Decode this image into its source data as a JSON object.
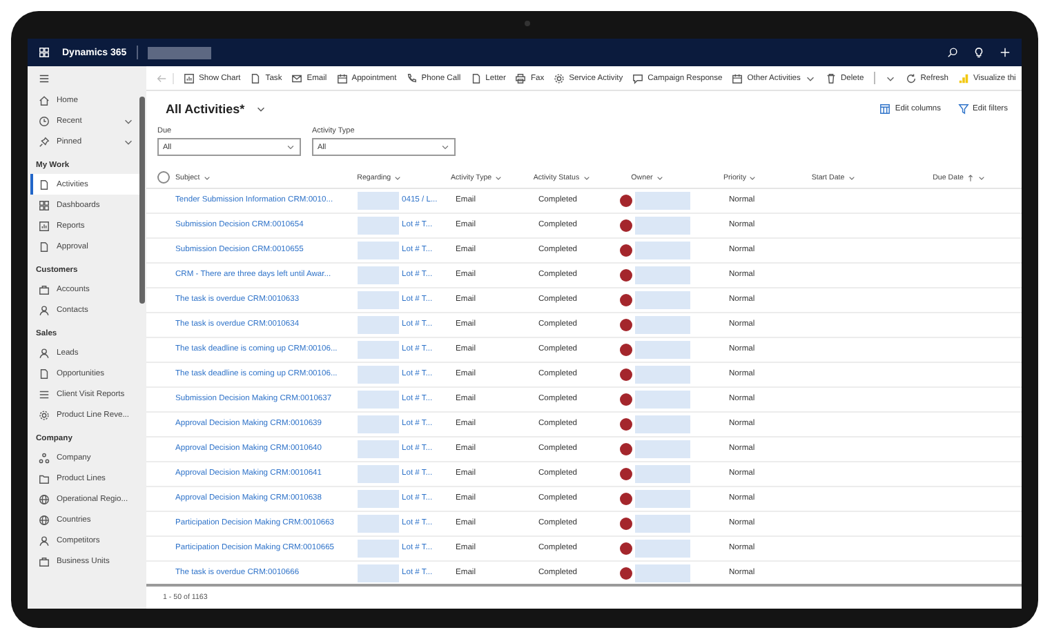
{
  "header": {
    "app_name": "Dynamics 365"
  },
  "sidebar": {
    "sections": [
      {
        "items": [
          {
            "label": "Home",
            "selected": false
          },
          {
            "label": "Recent",
            "selected": false,
            "expanded": false
          },
          {
            "label": "Pinned",
            "selected": false,
            "expanded": false
          }
        ]
      },
      {
        "title": "My Work",
        "items": [
          {
            "label": "Activities",
            "selected": true
          },
          {
            "label": "Dashboards",
            "selected": false
          },
          {
            "label": "Reports",
            "selected": false
          },
          {
            "label": "Approval",
            "selected": false
          }
        ]
      },
      {
        "title": "Customers",
        "items": [
          {
            "label": "Accounts",
            "selected": false
          },
          {
            "label": "Contacts",
            "selected": false
          }
        ]
      },
      {
        "title": "Sales",
        "items": [
          {
            "label": "Leads",
            "selected": false
          },
          {
            "label": "Opportunities",
            "selected": false
          },
          {
            "label": "Client Visit Reports",
            "selected": false
          },
          {
            "label": "Product Line Reve...",
            "selected": false
          }
        ]
      },
      {
        "title": "Company",
        "items": [
          {
            "label": "Company",
            "selected": false
          },
          {
            "label": "Product Lines",
            "selected": false
          },
          {
            "label": "Operational Regio...",
            "selected": false
          },
          {
            "label": "Countries",
            "selected": false
          },
          {
            "label": "Competitors",
            "selected": false
          },
          {
            "label": "Business Units",
            "selected": false
          }
        ]
      }
    ]
  },
  "commands": [
    {
      "label": "Show Chart",
      "kind": "button"
    },
    {
      "label": "Task",
      "kind": "button"
    },
    {
      "label": "Email",
      "kind": "button"
    },
    {
      "label": "Appointment",
      "kind": "button"
    },
    {
      "label": "Phone Call",
      "kind": "button"
    },
    {
      "label": "Letter",
      "kind": "button"
    },
    {
      "label": "Fax",
      "kind": "button"
    },
    {
      "label": "Service Activity",
      "kind": "button"
    },
    {
      "label": "Campaign Response",
      "kind": "button"
    },
    {
      "label": "Other Activities",
      "kind": "menu"
    },
    {
      "label": "Delete",
      "kind": "split"
    },
    {
      "label": "Refresh",
      "kind": "button"
    },
    {
      "label": "Visualize thi",
      "kind": "button"
    }
  ],
  "view": {
    "title": "All Activities*",
    "actions": [
      {
        "label": "Edit columns"
      },
      {
        "label": "Edit filters"
      }
    ]
  },
  "filters": [
    {
      "label": "Due",
      "value": "All"
    },
    {
      "label": "Activity Type",
      "value": "All"
    }
  ],
  "table": {
    "select_all_checked": false,
    "columns": [
      {
        "label": "Subject",
        "sorted": false
      },
      {
        "label": "Regarding",
        "sorted": false
      },
      {
        "label": "Activity Type",
        "sorted": false
      },
      {
        "label": "Activity Status",
        "sorted": false
      },
      {
        "label": "Owner",
        "sorted": false
      },
      {
        "label": "Priority",
        "sorted": false
      },
      {
        "label": "Start Date",
        "sorted": false
      },
      {
        "label": "Due Date",
        "sorted": true
      }
    ],
    "rows": [
      {
        "subject": "Tender Submission Information CRM:0010...",
        "regarding": "0415 / L...",
        "activity_type": "Email",
        "status": "Completed",
        "priority": "Normal"
      },
      {
        "subject": "Submission Decision CRM:0010654",
        "regarding": "Lot # T...",
        "activity_type": "Email",
        "status": "Completed",
        "priority": "Normal"
      },
      {
        "subject": "Submission Decision CRM:0010655",
        "regarding": "Lot # T...",
        "activity_type": "Email",
        "status": "Completed",
        "priority": "Normal"
      },
      {
        "subject": "CRM - There are three days left until Awar...",
        "regarding": "Lot # T...",
        "activity_type": "Email",
        "status": "Completed",
        "priority": "Normal"
      },
      {
        "subject": "The task is overdue CRM:0010633",
        "regarding": "Lot # T...",
        "activity_type": "Email",
        "status": "Completed",
        "priority": "Normal"
      },
      {
        "subject": "The task is overdue CRM:0010634",
        "regarding": "Lot # T...",
        "activity_type": "Email",
        "status": "Completed",
        "priority": "Normal"
      },
      {
        "subject": "The task deadline is coming up CRM:00106...",
        "regarding": "Lot # T...",
        "activity_type": "Email",
        "status": "Completed",
        "priority": "Normal"
      },
      {
        "subject": "The task deadline is coming up CRM:00106...",
        "regarding": "Lot # T...",
        "activity_type": "Email",
        "status": "Completed",
        "priority": "Normal"
      },
      {
        "subject": "Submission Decision Making CRM:0010637",
        "regarding": "Lot # T...",
        "activity_type": "Email",
        "status": "Completed",
        "priority": "Normal"
      },
      {
        "subject": "Approval Decision Making CRM:0010639",
        "regarding": "Lot # T...",
        "activity_type": "Email",
        "status": "Completed",
        "priority": "Normal"
      },
      {
        "subject": "Approval Decision Making CRM:0010640",
        "regarding": "Lot # T...",
        "activity_type": "Email",
        "status": "Completed",
        "priority": "Normal"
      },
      {
        "subject": "Approval Decision Making CRM:0010641",
        "regarding": "Lot # T...",
        "activity_type": "Email",
        "status": "Completed",
        "priority": "Normal"
      },
      {
        "subject": "Approval Decision Making CRM:0010638",
        "regarding": "Lot # T...",
        "activity_type": "Email",
        "status": "Completed",
        "priority": "Normal"
      },
      {
        "subject": "Participation Decision Making CRM:0010663",
        "regarding": "Lot # T...",
        "activity_type": "Email",
        "status": "Completed",
        "priority": "Normal"
      },
      {
        "subject": "Participation Decision Making CRM:0010665",
        "regarding": "Lot # T...",
        "activity_type": "Email",
        "status": "Completed",
        "priority": "Normal"
      },
      {
        "subject": "The task is overdue CRM:0010666",
        "regarding": "Lot # T...",
        "activity_type": "Email",
        "status": "Completed",
        "priority": "Normal"
      }
    ]
  },
  "footer": {
    "record_count": "1 - 50 of 1163"
  }
}
